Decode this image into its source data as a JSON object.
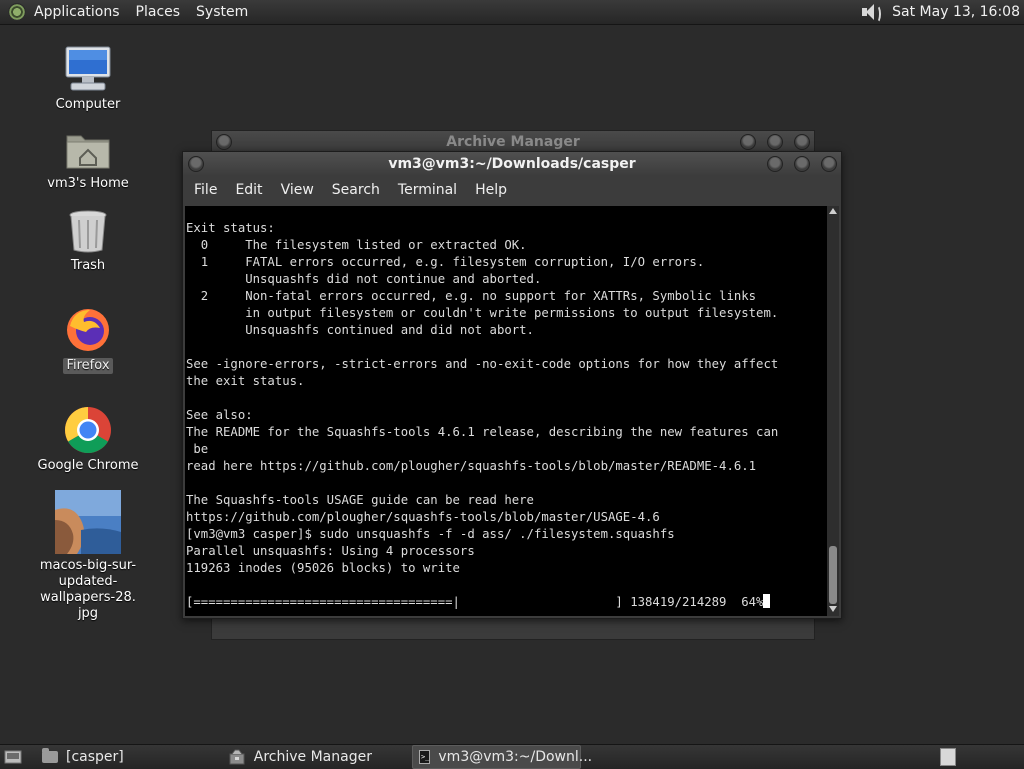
{
  "top_panel": {
    "menus": [
      "Applications",
      "Places",
      "System"
    ],
    "clock": "Sat May 13, 16:08"
  },
  "desktop": {
    "icons": [
      {
        "label": "Computer"
      },
      {
        "label": "vm3's Home"
      },
      {
        "label": "Trash"
      },
      {
        "label": "Firefox"
      },
      {
        "label": "Google Chrome"
      },
      {
        "label": "macos-big-sur-\nupdated-wallpapers-28.\njpg"
      }
    ]
  },
  "archive_window": {
    "title": "Archive Manager"
  },
  "terminal_window": {
    "title": "vm3@vm3:~/Downloads/casper",
    "menu": [
      "File",
      "Edit",
      "View",
      "Search",
      "Terminal",
      "Help"
    ],
    "output": "Exit status:\n  0     The filesystem listed or extracted OK.\n  1     FATAL errors occurred, e.g. filesystem corruption, I/O errors.\n        Unsquashfs did not continue and aborted.\n  2     Non-fatal errors occurred, e.g. no support for XATTRs, Symbolic links\n        in output filesystem or couldn't write permissions to output filesystem.\n        Unsquashfs continued and did not abort.\n\nSee -ignore-errors, -strict-errors and -no-exit-code options for how they affect\nthe exit status.\n\nSee also:\nThe README for the Squashfs-tools 4.6.1 release, describing the new features can\n be\nread here https://github.com/plougher/squashfs-tools/blob/master/README-4.6.1\n\nThe Squashfs-tools USAGE guide can be read here\nhttps://github.com/plougher/squashfs-tools/blob/master/USAGE-4.6\n[vm3@vm3 casper]$ sudo unsquashfs -f -d ass/ ./filesystem.squashfs\nParallel unsquashfs: Using 4 processors\n119263 inodes (95026 blocks) to write\n\n",
    "progress_line": "[===================================|                     ] 138419/214289  64%",
    "progress_percent": 64
  },
  "taskbar": {
    "items": [
      {
        "label": "[casper]"
      },
      {
        "label": "Archive Manager"
      },
      {
        "label": "vm3@vm3:~/Downl..."
      }
    ]
  }
}
